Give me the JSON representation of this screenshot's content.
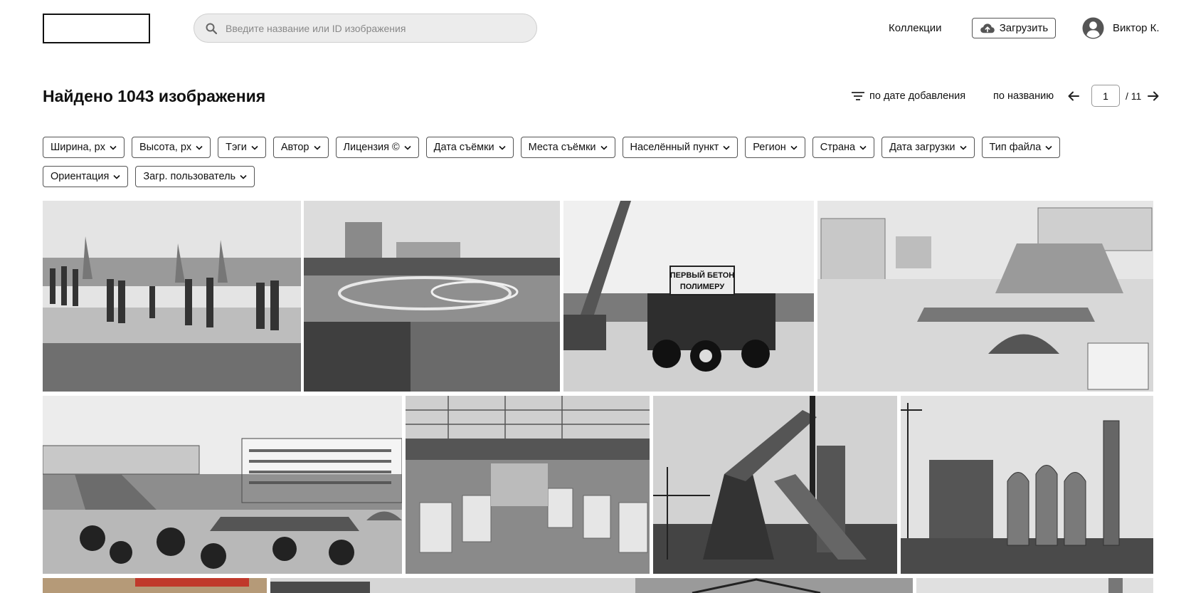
{
  "header": {
    "search_placeholder": "Введите название или ID изображения",
    "collections_label": "Коллекции",
    "upload_label": "Загрузить",
    "user_name": "Виктор К."
  },
  "results": {
    "title": "Найдено 1043 изображения",
    "sort_by_date": "по дате добавления",
    "sort_by_name": "по названию",
    "current_page": "1",
    "total_pages": "/ 11"
  },
  "filters": [
    "Ширина, px",
    "Высота, px",
    "Тэги",
    "Автор",
    "Лицензия ©",
    "Дата съёмки",
    "Места съёмки",
    "Населённый пункт",
    "Регион",
    "Страна",
    "Дата загрузки",
    "Тип файла",
    "Ориентация",
    "Загр. пользователь"
  ],
  "icons": {
    "search": "search-icon",
    "upload": "cloud-upload-icon",
    "user": "user-avatar-icon",
    "sort": "sort-lines-icon",
    "prev": "arrow-left-icon",
    "next": "arrow-right-icon",
    "chevron": "chevron-down-icon"
  },
  "photos": [
    {
      "name": "photo-folk-dancers"
    },
    {
      "name": "photo-stadium-parade"
    },
    {
      "name": "photo-truck-first-concrete",
      "sign_text": [
        "ПЕРВЫЙ БЕТОН",
        "ПОЛИМЕРУ"
      ]
    },
    {
      "name": "photo-city-square"
    },
    {
      "name": "photo-government-buildings"
    },
    {
      "name": "photo-factory-hall"
    },
    {
      "name": "photo-blast-furnace"
    },
    {
      "name": "photo-steel-plant"
    },
    {
      "name": "photo-banner-street"
    },
    {
      "name": "photo-trees"
    },
    {
      "name": "photo-industrial-frame"
    },
    {
      "name": "photo-building-edge"
    }
  ],
  "colors": {
    "text": "#111111",
    "search_bg": "#ececec",
    "border": "#555555"
  }
}
